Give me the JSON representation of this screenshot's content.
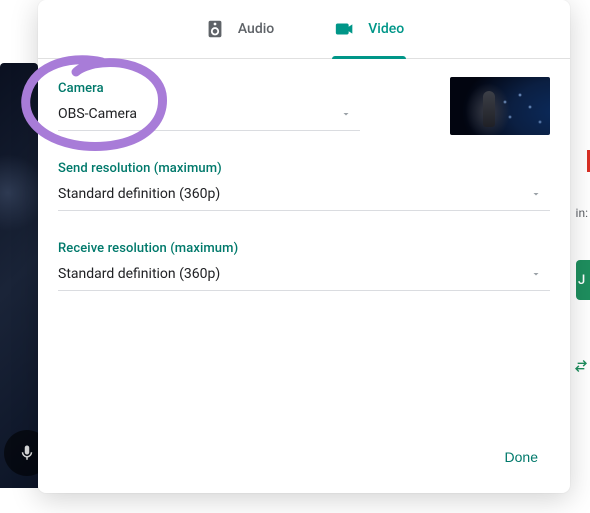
{
  "tabs": {
    "audio_label": "Audio",
    "video_label": "Video",
    "active": "video"
  },
  "fields": {
    "camera": {
      "label": "Camera",
      "value": "OBS-Camera"
    },
    "send_res": {
      "label": "Send resolution (maximum)",
      "value": "Standard definition (360p)"
    },
    "recv_res": {
      "label": "Receive resolution (maximum)",
      "value": "Standard definition (360p)"
    }
  },
  "actions": {
    "done_label": "Done"
  },
  "background": {
    "pin_fragment": "in:",
    "join_fragment": "J"
  },
  "colors": {
    "accent": "#00796b",
    "annotation": "#a87cd8"
  }
}
